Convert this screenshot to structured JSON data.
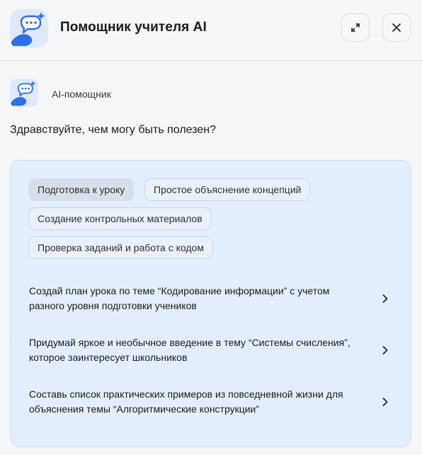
{
  "header": {
    "title": "Помощник учителя AI",
    "expand_icon": "expand-icon",
    "close_icon": "close-icon"
  },
  "assistant": {
    "name": "AI-помощник",
    "avatar_icon": "assistant-chat-sparkle-icon"
  },
  "chat": {
    "greeting": "Здравствуйте, чем могу быть полезен?"
  },
  "panel": {
    "tabs": [
      {
        "label": "Подготовка к уроку",
        "active": true
      },
      {
        "label": "Простое объяснение концепций",
        "active": false
      },
      {
        "label": "Создание контрольных материалов",
        "active": false
      },
      {
        "label": "Проверка заданий и работа с кодом",
        "active": false
      }
    ],
    "suggestions": [
      {
        "text": "Создай план урока по теме “Кодирование информации” с учетом разного уровня подготовки учеников"
      },
      {
        "text": "Придумай яркое и необычное введение в тему “Системы счисления”, которое заинтересует школьников"
      },
      {
        "text": "Составь список практических примеров из повседневной жизни для объяснения темы “Алгоритмические конструкции”"
      }
    ]
  },
  "colors": {
    "panel_bg": "#e3eefc",
    "brand_blue": "#2e6ee6",
    "brand_light": "#dfe9fb"
  }
}
